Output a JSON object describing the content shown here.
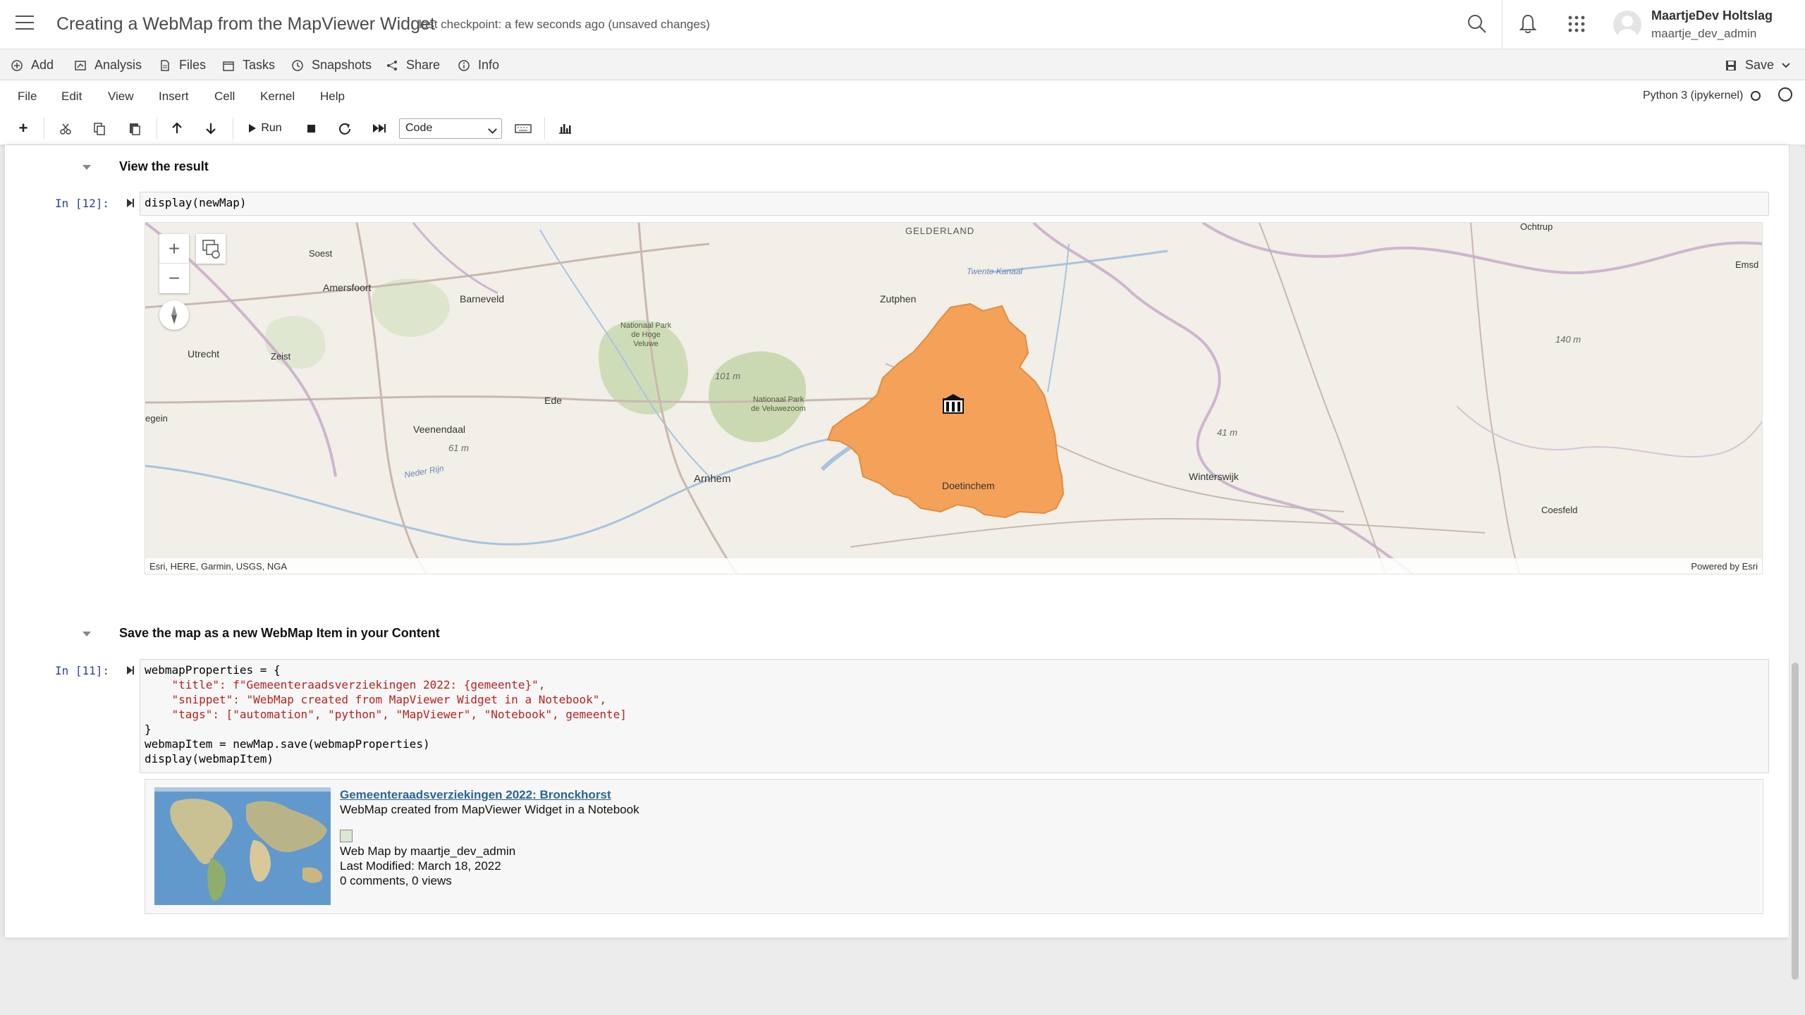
{
  "header": {
    "doc_title": "Creating a WebMap from the MapViewer Widget",
    "checkpoint": "last checkpoint: a few seconds ago (unsaved changes)",
    "user_name": "MaartjeDev Holtslag",
    "user_login": "maartje_dev_admin"
  },
  "nb_toolbar": {
    "items": [
      "Add",
      "Analysis",
      "Files",
      "Tasks",
      "Snapshots",
      "Share",
      "Info"
    ],
    "save_label": "Save"
  },
  "menu": {
    "items": [
      "File",
      "Edit",
      "View",
      "Insert",
      "Cell",
      "Kernel",
      "Help"
    ],
    "kernel": "Python 3 (ipykernel)"
  },
  "cell_toolbar": {
    "run_label": "Run",
    "cell_type": "Code"
  },
  "cells": {
    "md1": "View the result",
    "code1_prompt": "In [12]:",
    "code1_text": "display(newMap)",
    "md2": "Save the map as a new WebMap Item in your Content",
    "code2_prompt": "In [11]:",
    "code2_lines": [
      "webmapProperties = {",
      "    \"title\": f\"Gemeenteraadsverziekingen 2022: {gemeente}\",",
      "    \"snippet\": \"WebMap created from MapViewer Widget in a Notebook\",",
      "    \"tags\": [\"automation\", \"python\", \"MapViewer\", \"Notebook\", gemeente]",
      "}",
      "webmapItem = newMap.save(webmapProperties)",
      "display(webmapItem)"
    ]
  },
  "map": {
    "attribution": "Esri, HERE, Garmin, USGS, NGA",
    "powered_by": "Powered by Esri",
    "polygon_color": "#f4a259",
    "places": {
      "soest": "Soest",
      "amersfoort": "Amersfoort",
      "barneveld": "Barneveld",
      "utrecht": "Utrecht",
      "zeist": "Zeist",
      "ede": "Ede",
      "veenendaal": "Veenendaal",
      "arnhem": "Arnhem",
      "zutphen": "Zutphen",
      "doetinchem": "Doetinchem",
      "winterswijk": "Winterswijk",
      "coesfeld": "Coesfeld",
      "ochtrup": "Ochtrup",
      "emsd": "Emsd",
      "egein": "egein",
      "gelderland": "GELDERLAND",
      "hoge_veluwe": "Nationaal Park de Hoge Veluwe",
      "veluwezoom": "Nationaal Park de Veluwezoom",
      "twente": "Twente Kanaal",
      "nederrijn": "Neder Rijn",
      "h101": "101 m",
      "h61": "61 m",
      "h41": "41 m",
      "h140": "140 m"
    }
  },
  "item": {
    "title": "Gemeenteraadsverziekingen 2022: Bronckhorst",
    "snippet": "WebMap created from MapViewer Widget in a Notebook",
    "owner": "Web Map by maartje_dev_admin",
    "modified": "Last Modified: March 18, 2022",
    "stats": "0 comments, 0 views"
  }
}
